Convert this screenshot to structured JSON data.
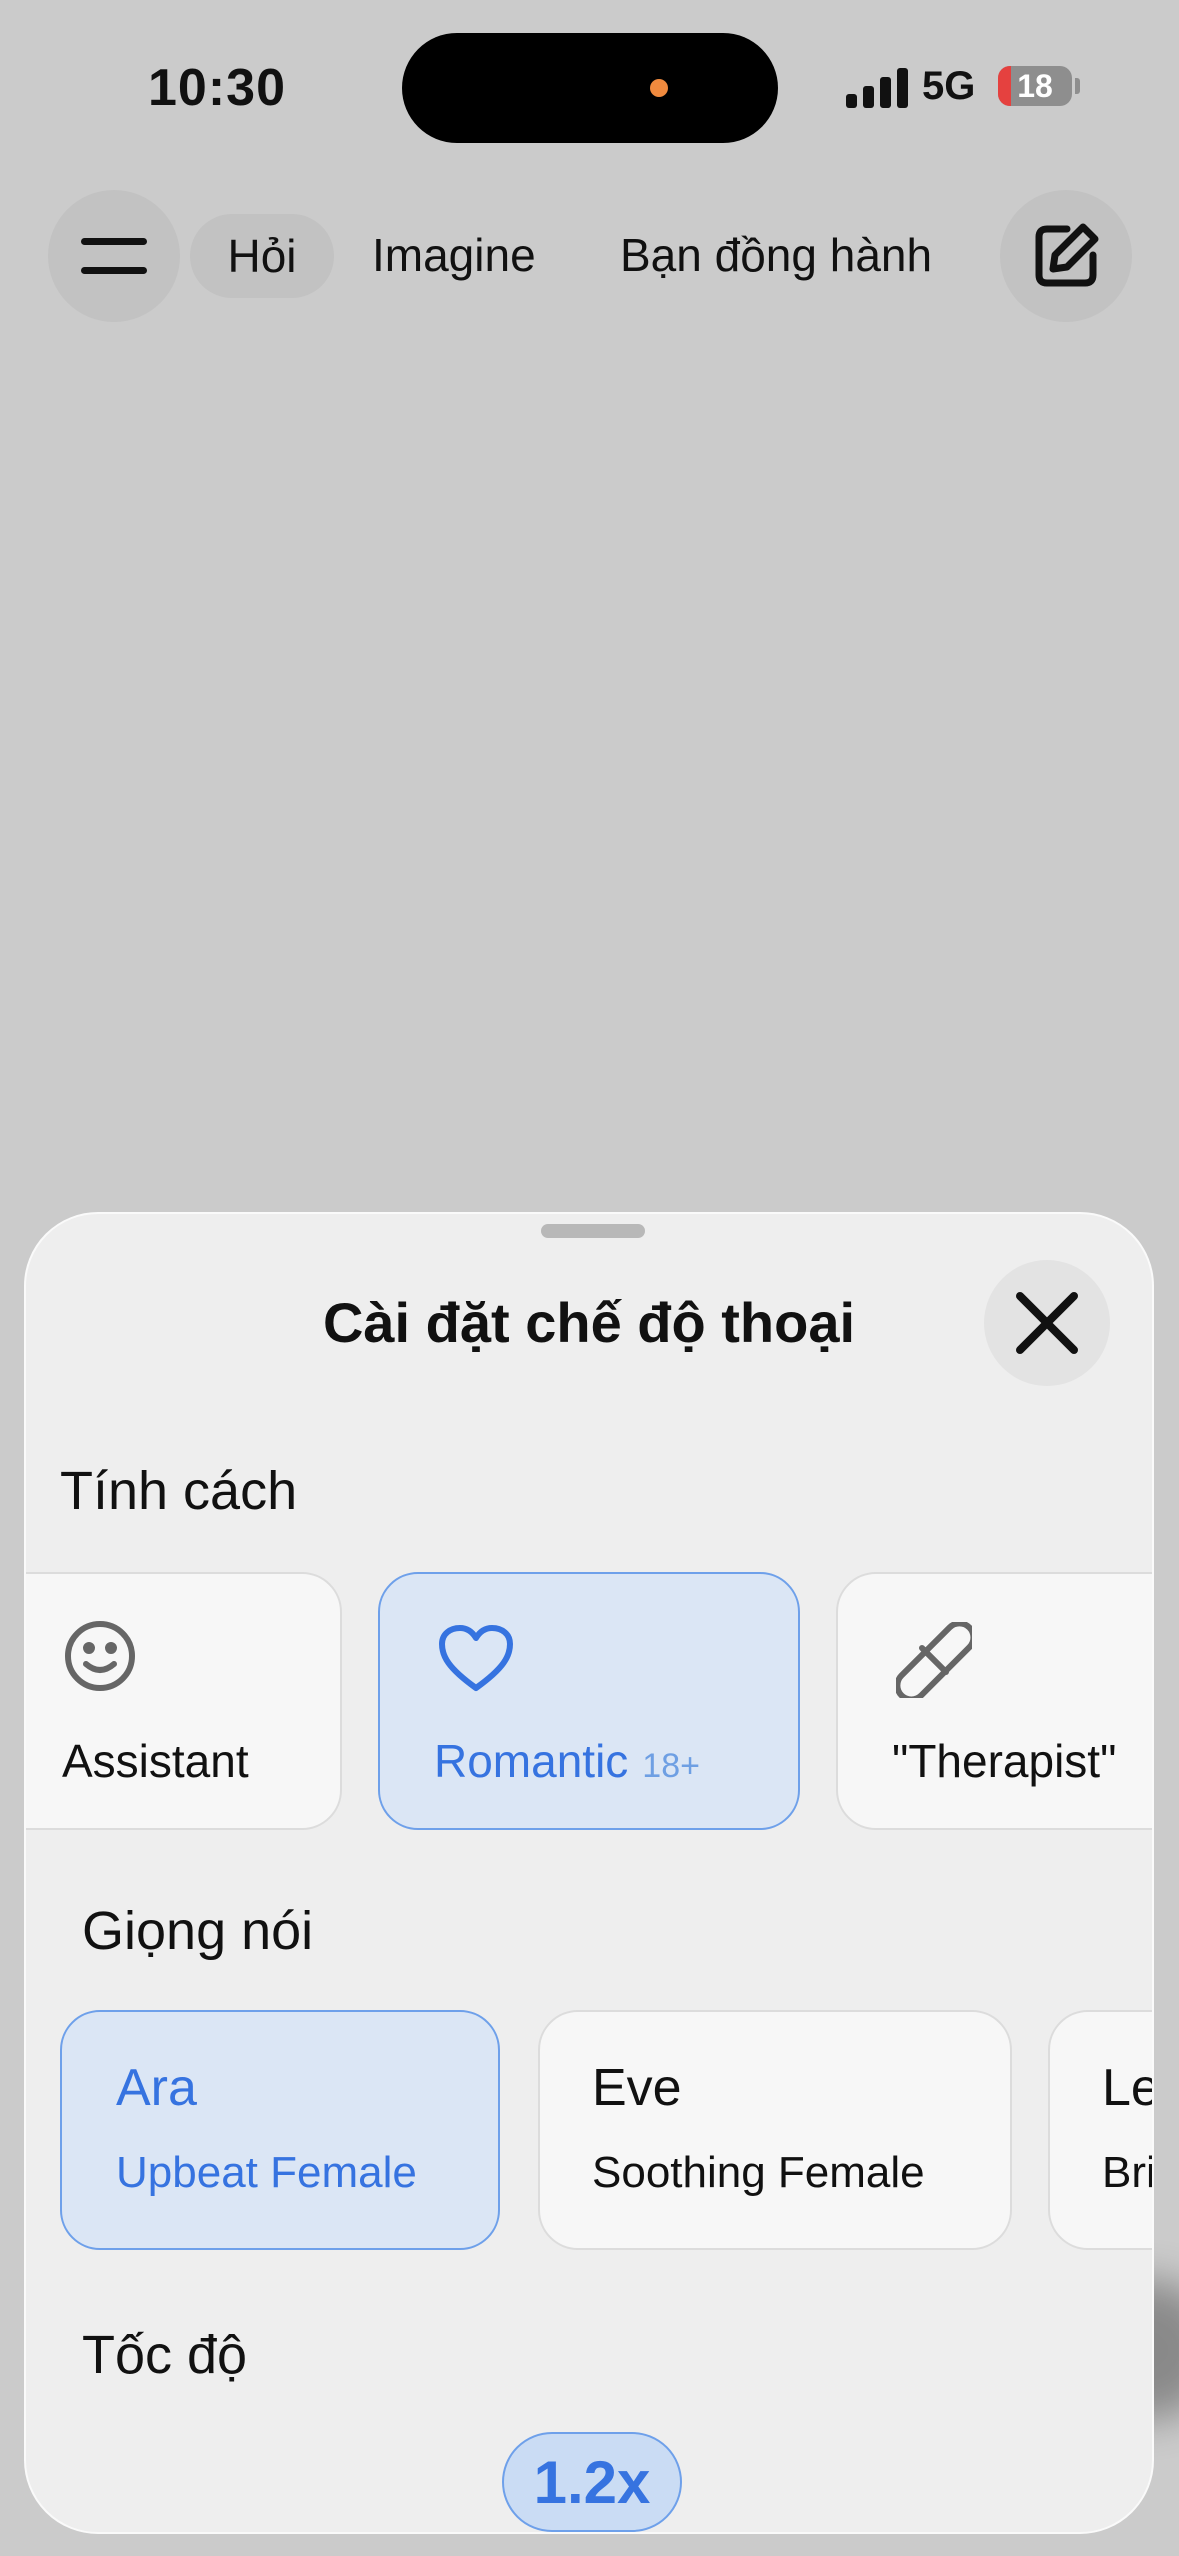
{
  "status_bar": {
    "time": "10:30",
    "network": "5G",
    "battery": "18",
    "battery_level": 0.18
  },
  "nav": {
    "tabs": [
      "Hỏi",
      "Imagine",
      "Bạn đồng hành"
    ]
  },
  "sheet": {
    "title": "Cài đặt chế độ thoại",
    "personality": {
      "title": "Tính cách",
      "items": [
        {
          "label": "Assistant",
          "icon": "smile-icon",
          "selected": false
        },
        {
          "label": "Romantic",
          "badge": "18+",
          "icon": "heart-icon",
          "selected": true
        },
        {
          "label": "\"Therapist\"",
          "icon": "pill-icon",
          "selected": false
        }
      ]
    },
    "voice": {
      "title": "Giọng nói",
      "items": [
        {
          "name": "Ara",
          "desc": "Upbeat Female",
          "selected": true
        },
        {
          "name": "Eve",
          "desc": "Soothing Female",
          "selected": false
        },
        {
          "name": "Le",
          "desc": "Bri",
          "selected": false
        }
      ]
    },
    "speed": {
      "title": "Tốc độ",
      "value": "1.2x"
    }
  },
  "colors": {
    "accent": "#3673e0",
    "selected_bg": "#dbe6f5",
    "background": "#cbcbcb",
    "sheet_bg": "#eeeeee"
  }
}
